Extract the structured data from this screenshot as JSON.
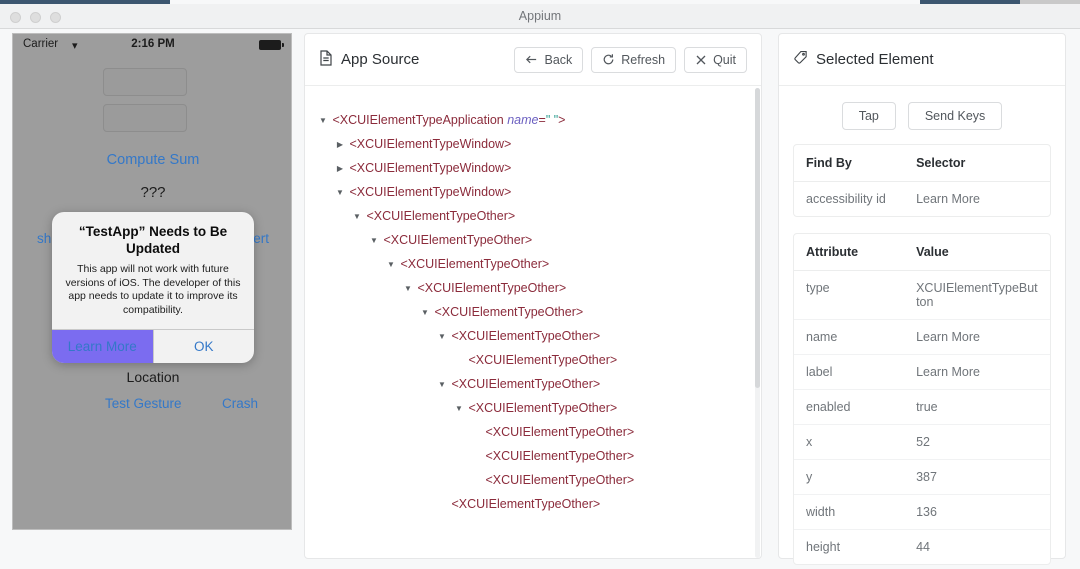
{
  "window": {
    "title": "Appium",
    "traffic_lights": [
      "close",
      "minimize",
      "maximize"
    ]
  },
  "simulator": {
    "status_bar": {
      "carrier": "Carrier",
      "wifi_icon": "wifi-icon",
      "time": "2:16 PM",
      "battery_icon": "battery-icon"
    },
    "fields": [
      {
        "name": "first-number-field",
        "value": ""
      },
      {
        "name": "second-number-field",
        "value": ""
      }
    ],
    "compute_sum_label": "Compute Sum",
    "sum_result": "???",
    "show_alert_left": "sh",
    "show_alert_right": "ert",
    "location_label": "Location",
    "test_gesture_label": "Test Gesture",
    "crash_label": "Crash",
    "alert": {
      "title": "“TestApp” Needs to Be Updated",
      "message": "This app will not work with future versions of iOS. The developer of this app needs to update it to improve its compatibility.",
      "buttons": [
        {
          "label": "Learn More",
          "highlighted": true
        },
        {
          "label": "OK",
          "highlighted": false
        }
      ],
      "highlight_color": "#7b6cf0"
    }
  },
  "source_panel": {
    "title": "App Source",
    "title_icon": "file-icon",
    "buttons": [
      {
        "label": "Back",
        "icon": "arrow-left-icon"
      },
      {
        "label": "Refresh",
        "icon": "refresh-icon"
      },
      {
        "label": "Quit",
        "icon": "close-icon"
      }
    ],
    "tree": [
      {
        "depth": 0,
        "caret": "down",
        "tag": "<XCUIElementTypeApplication",
        "attr_key": "name",
        "attr_val": "\" \"",
        "tag_close": ">"
      },
      {
        "depth": 1,
        "caret": "right",
        "tag": "<XCUIElementTypeWindow>"
      },
      {
        "depth": 1,
        "caret": "right",
        "tag": "<XCUIElementTypeWindow>"
      },
      {
        "depth": 1,
        "caret": "down",
        "tag": "<XCUIElementTypeWindow>"
      },
      {
        "depth": 2,
        "caret": "down",
        "tag": "<XCUIElementTypeOther>"
      },
      {
        "depth": 3,
        "caret": "down",
        "tag": "<XCUIElementTypeOther>"
      },
      {
        "depth": 4,
        "caret": "down",
        "tag": "<XCUIElementTypeOther>"
      },
      {
        "depth": 5,
        "caret": "down",
        "tag": "<XCUIElementTypeOther>"
      },
      {
        "depth": 6,
        "caret": "down",
        "tag": "<XCUIElementTypeOther>"
      },
      {
        "depth": 7,
        "caret": "down",
        "tag": "<XCUIElementTypeOther>"
      },
      {
        "depth": 8,
        "caret": "none",
        "tag": "<XCUIElementTypeOther>"
      },
      {
        "depth": 7,
        "caret": "down",
        "tag": "<XCUIElementTypeOther>"
      },
      {
        "depth": 8,
        "caret": "down",
        "tag": "<XCUIElementTypeOther>"
      },
      {
        "depth": 9,
        "caret": "none",
        "tag": "<XCUIElementTypeOther>"
      },
      {
        "depth": 9,
        "caret": "none",
        "tag": "<XCUIElementTypeOther>"
      },
      {
        "depth": 9,
        "caret": "none",
        "tag": "<XCUIElementTypeOther>"
      },
      {
        "depth": 7,
        "caret": "none",
        "tag": "<XCUIElementTypeOther>"
      }
    ]
  },
  "inspector_panel": {
    "title": "Selected Element",
    "title_icon": "tag-icon",
    "actions": [
      {
        "label": "Tap"
      },
      {
        "label": "Send Keys"
      }
    ],
    "find_by_table": {
      "headers": [
        "Find By",
        "Selector"
      ],
      "rows": [
        {
          "find_by": "accessibility id",
          "selector": "Learn More"
        }
      ]
    },
    "attributes_table": {
      "headers": [
        "Attribute",
        "Value"
      ],
      "rows": [
        {
          "attribute": "type",
          "value": "XCUIElementTypeButton"
        },
        {
          "attribute": "name",
          "value": "Learn More"
        },
        {
          "attribute": "label",
          "value": "Learn More"
        },
        {
          "attribute": "enabled",
          "value": "true"
        },
        {
          "attribute": "x",
          "value": "52"
        },
        {
          "attribute": "y",
          "value": "387"
        },
        {
          "attribute": "width",
          "value": "136"
        },
        {
          "attribute": "height",
          "value": "44"
        }
      ]
    }
  }
}
